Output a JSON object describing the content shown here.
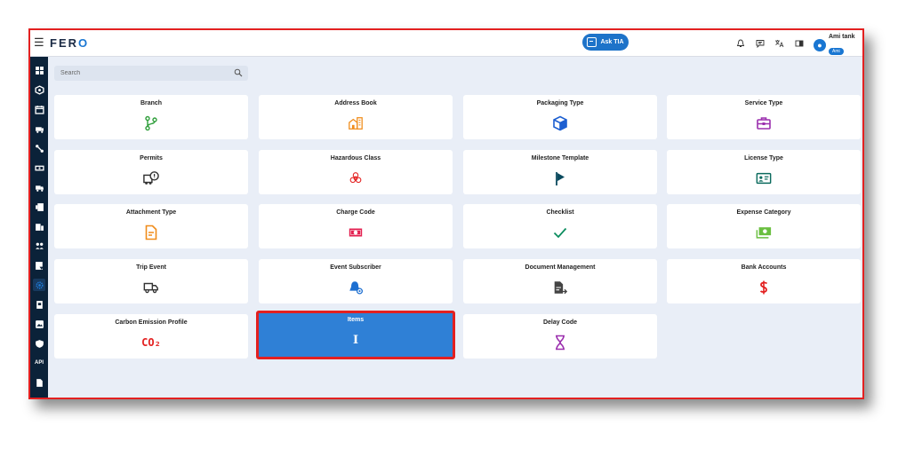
{
  "header": {
    "logo_main": "FER",
    "logo_accent": "O",
    "ask_label": "Ask TIA",
    "user_name": "Ami tank",
    "user_tag": "Ami"
  },
  "search": {
    "placeholder": "Search"
  },
  "cards": [
    {
      "label": "Branch",
      "icon": "branch-icon",
      "color": "#2e9e3a"
    },
    {
      "label": "Address Book",
      "icon": "address-book-icon",
      "color": "#f08c1a"
    },
    {
      "label": "Packaging Type",
      "icon": "box-icon",
      "color": "#1d5fd1"
    },
    {
      "label": "Service Type",
      "icon": "toolbox-icon",
      "color": "#9b2fae"
    },
    {
      "label": "Permits",
      "icon": "permit-truck-icon",
      "color": "#333333"
    },
    {
      "label": "Hazardous Class",
      "icon": "biohazard-icon",
      "color": "#e32020"
    },
    {
      "label": "Milestone Template",
      "icon": "flag-icon",
      "color": "#0b4a5e"
    },
    {
      "label": "License Type",
      "icon": "id-card-icon",
      "color": "#0b6b5e"
    },
    {
      "label": "Attachment Type",
      "icon": "document-icon",
      "color": "#f08c1a"
    },
    {
      "label": "Charge Code",
      "icon": "cash-icon",
      "color": "#e32050"
    },
    {
      "label": "Checklist",
      "icon": "check-icon",
      "color": "#0b8c5e"
    },
    {
      "label": "Expense Category",
      "icon": "money-icon",
      "color": "#6abf40"
    },
    {
      "label": "Trip Event",
      "icon": "truck-icon",
      "color": "#333333"
    },
    {
      "label": "Event Subscriber",
      "icon": "bell-gear-icon",
      "color": "#1d6fd1"
    },
    {
      "label": "Document Management",
      "icon": "file-export-icon",
      "color": "#444444"
    },
    {
      "label": "Bank Accounts",
      "icon": "dollar-icon",
      "color": "#e32020"
    },
    {
      "label": "Carbon Emission Profile",
      "icon": "co2-icon",
      "color": "#e32020",
      "icon_text": "CO₂"
    },
    {
      "label": "Items",
      "icon": "text-cursor-icon",
      "color": "#ffffff",
      "icon_text": "I"
    },
    {
      "label": "Delay Code",
      "icon": "hourglass-icon",
      "color": "#9b2fae"
    }
  ]
}
